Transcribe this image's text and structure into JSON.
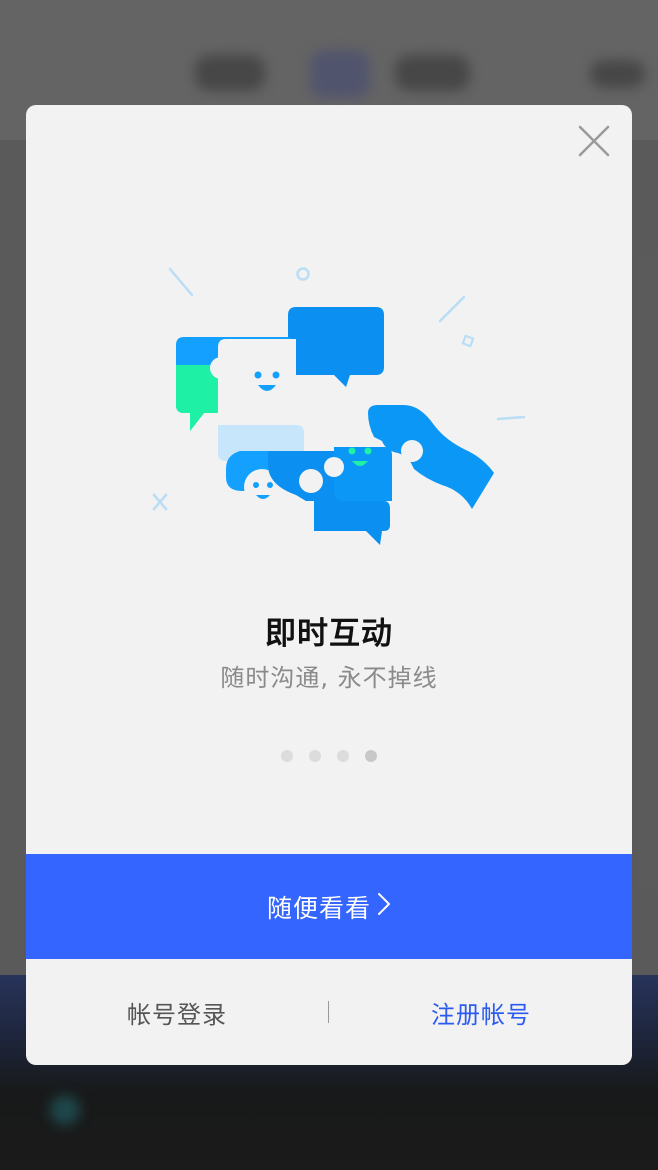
{
  "modal": {
    "headline": "即时互动",
    "subline": "随时沟通, 永不掉线",
    "pager": {
      "count": 4,
      "active_index": 4
    },
    "browse_button": {
      "label": "随便看看",
      "icon": "chevron-right-icon"
    },
    "login_link": "帐号登录",
    "register_link": "注册帐号",
    "close_icon": "close-icon"
  },
  "colors": {
    "primary": "#3565ff",
    "link": "#2b5bf0",
    "illustration_blue": "#0b97f5",
    "illustration_green": "#1ef0a6",
    "modal_bg": "#f2f2f2"
  }
}
